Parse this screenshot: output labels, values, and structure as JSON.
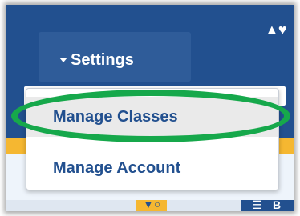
{
  "toolbar": {
    "settings_label": "Settings",
    "logo_glyph": "▲♥",
    "filter_glyph": "▼○",
    "view_glyph": "☰",
    "view_label": "B"
  },
  "settings_menu": {
    "items": [
      {
        "label": "Manage Classes",
        "highlighted": true
      },
      {
        "label": "Manage Account",
        "highlighted": false
      }
    ]
  },
  "annotation": {
    "shape": "ellipse",
    "color": "#16a84b",
    "target": "Manage Classes"
  },
  "colors": {
    "header_blue": "#22508f",
    "button_blue": "#2f5c99",
    "accent_yellow": "#f5b731",
    "menu_text": "#22508f",
    "highlight_gray": "#eaeaea"
  },
  "icons": [
    "caret-down-icon",
    "logo-icon",
    "filter-icon",
    "list-icon"
  ]
}
